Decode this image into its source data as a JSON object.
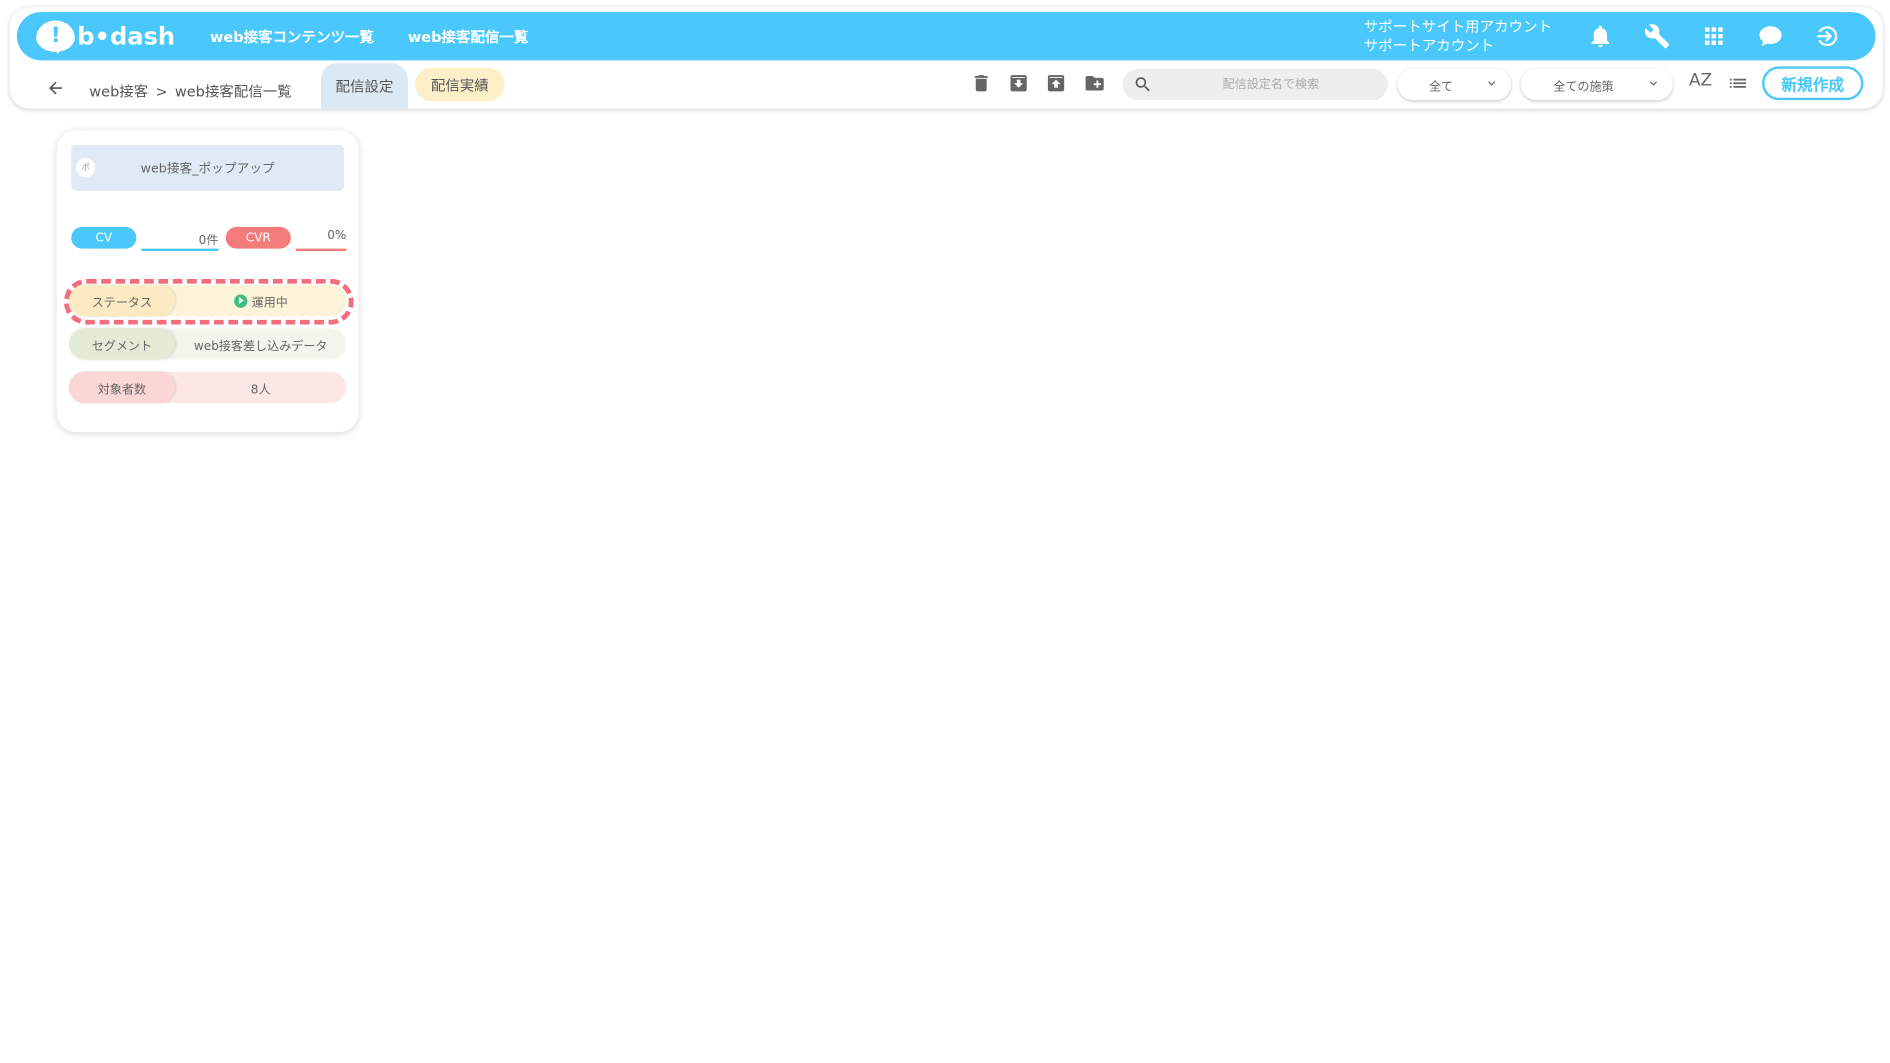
{
  "header": {
    "logo_text": "b•dash",
    "nav": [
      "web接客コンテンツ一覧",
      "web接客配信一覧"
    ],
    "account_line1": "サポートサイト用アカウント",
    "account_line2": "サポートアカウント",
    "icons": [
      "bell-icon",
      "wrench-icon",
      "apps-grid-icon",
      "chat-icon",
      "logout-icon"
    ],
    "brand_color": "#4ac8fb"
  },
  "subheader": {
    "breadcrumb_root": "web接客",
    "breadcrumb_sep": ">",
    "breadcrumb_current": "web接客配信一覧",
    "tabs": [
      "配信設定",
      "配信実績"
    ],
    "tools": [
      "trash-icon",
      "archive-down-icon",
      "archive-up-icon",
      "folder-add-icon"
    ],
    "search_placeholder": "配信設定名で検索",
    "filter_all": "全て",
    "filter_measures": "全ての施策",
    "sort_label": "AZ",
    "new_button": "新規作成"
  },
  "card": {
    "mini_icon": "ポ",
    "title": "web接客_ポップアップ",
    "cv_label": "CV",
    "cv_value": "0件",
    "cvr_label": "CVR",
    "cvr_value": "0%",
    "status_label": "ステータス",
    "status_value": "運用中",
    "segment_label": "セグメント",
    "segment_value": "web接客差し込みデータ",
    "count_label": "対象者数",
    "count_value": "8人"
  }
}
